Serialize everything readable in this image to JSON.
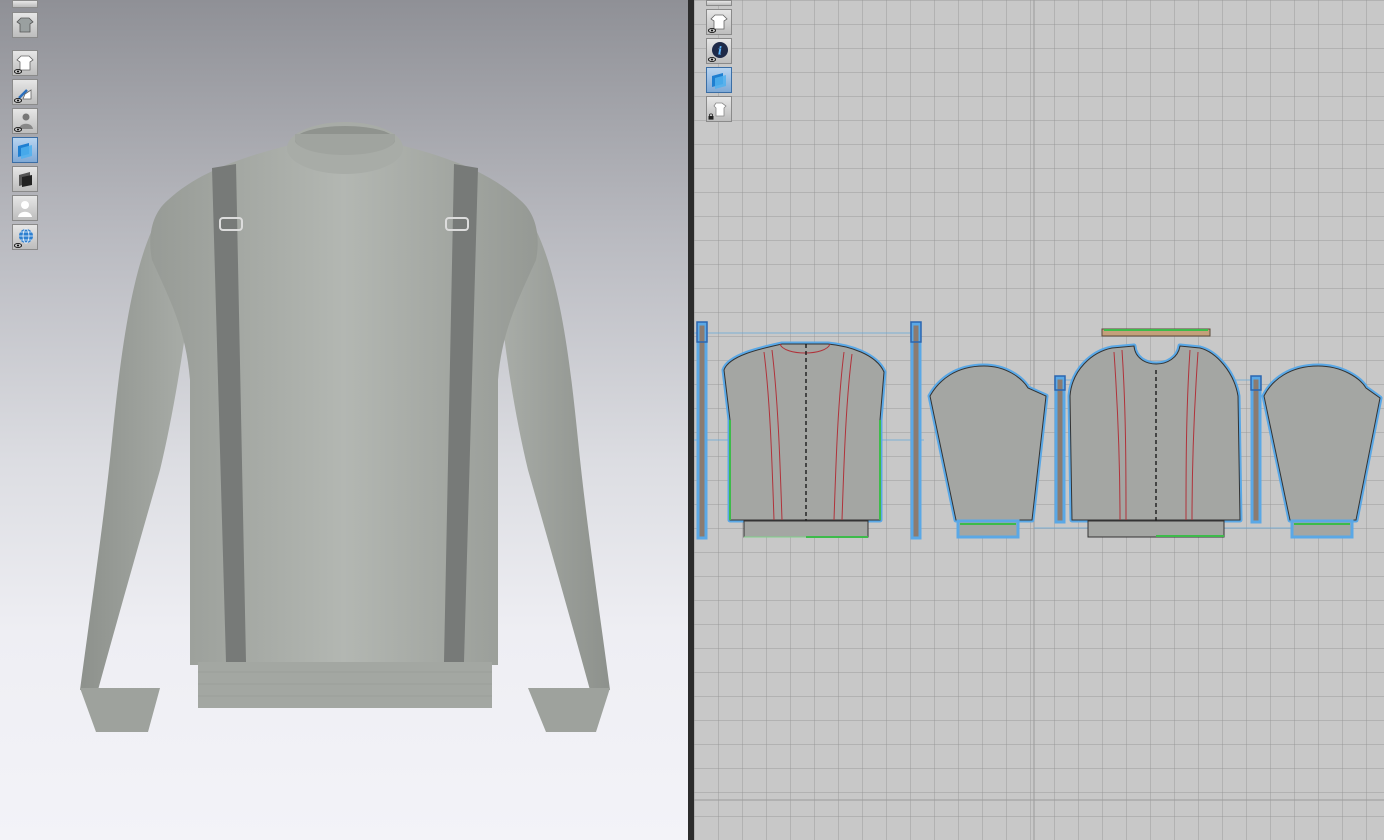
{
  "app": {
    "views": [
      "3d-garment-view",
      "2d-pattern-view"
    ]
  },
  "left_toolbar": {
    "items": [
      {
        "icon": "fold-icon",
        "active": false
      },
      {
        "icon": "garment-icon",
        "active": false
      },
      {
        "icon": "show-garment-icon",
        "active": false
      },
      {
        "icon": "show-pins-icon",
        "active": false
      },
      {
        "icon": "show-avatar-icon",
        "active": false
      },
      {
        "icon": "texture-mode-icon",
        "active": true
      },
      {
        "icon": "shading-icon",
        "active": false
      },
      {
        "icon": "avatar-surface-icon",
        "active": false
      },
      {
        "icon": "mesh-view-icon",
        "active": false
      }
    ]
  },
  "right_toolbar": {
    "items": [
      {
        "icon": "pattern-visibility-icon",
        "active": false
      },
      {
        "icon": "show-pattern-garment-icon",
        "active": false
      },
      {
        "icon": "info-icon",
        "active": false
      },
      {
        "icon": "fabric-texture-icon",
        "active": true
      },
      {
        "icon": "lock-garment-icon",
        "active": false
      }
    ]
  },
  "colors": {
    "garment": "#a7aba6",
    "strap": "#777a78",
    "pattern_fill": "#a4a6a3",
    "seam_blue": "#5aa8e6",
    "internal_line": "#b0323a",
    "stitch_green": "#3dbb4a",
    "strap_brown": "#8a7a6e",
    "grid": "#c8c8c8"
  }
}
